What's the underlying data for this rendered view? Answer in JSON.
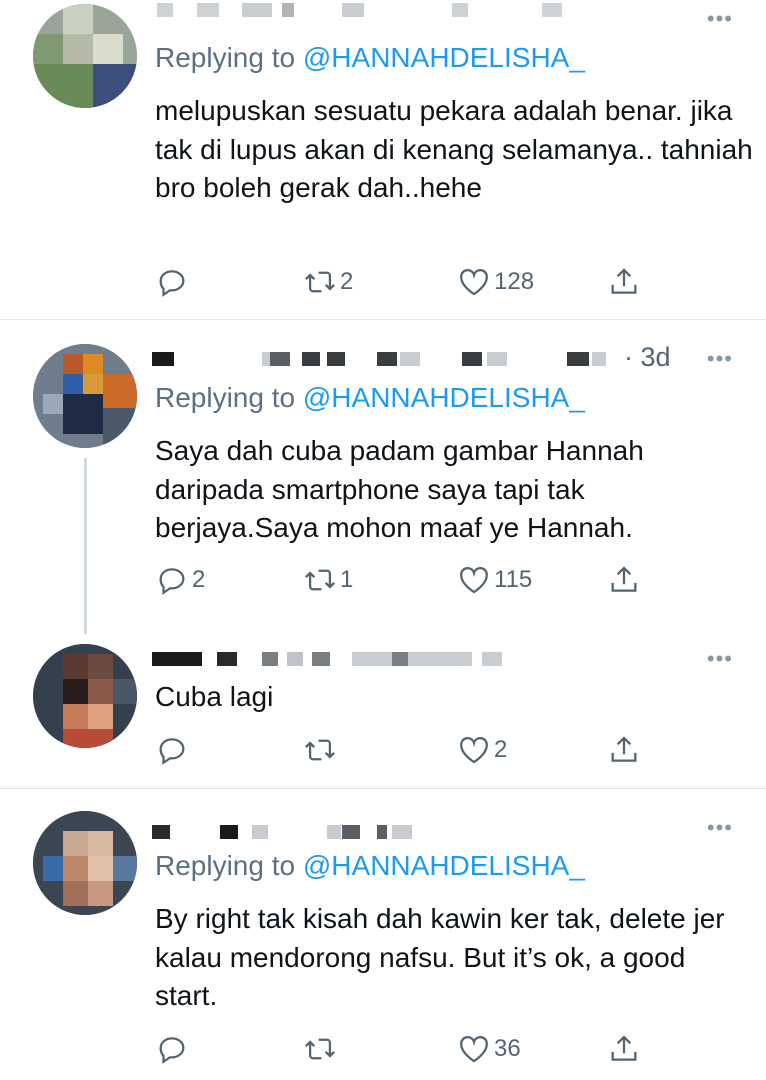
{
  "tweets": [
    {
      "replying_prefix": "Replying to",
      "replying_handle": "@HANNAHDELISHA_",
      "body": "melupuskan sesuatu pekara adalah benar. jika tak di lupus akan di kenang selamanya.. tahniah bro boleh gerak dah..hehe",
      "time": "",
      "replies": "",
      "retweets": "2",
      "likes": "128"
    },
    {
      "replying_prefix": "Replying to",
      "replying_handle": "@HANNAHDELISHA_",
      "body": "Saya dah cuba padam gambar Hannah daripada smartphone saya tapi tak berjaya.Saya mohon maaf ye Hannah.",
      "time": "· 3d",
      "replies": "2",
      "retweets": "1",
      "likes": "115"
    },
    {
      "replying_prefix": "",
      "replying_handle": "",
      "body": "Cuba lagi",
      "time": "",
      "replies": "",
      "retweets": "",
      "likes": "2"
    },
    {
      "replying_prefix": "Replying to",
      "replying_handle": "@HANNAHDELISHA_",
      "body": "By right tak kisah dah kawin ker tak, delete jer kalau mendorong nafsu. But it’s ok, a good start.",
      "time": "",
      "replies": "",
      "retweets": "",
      "likes": "36"
    }
  ],
  "more_label": "•••",
  "icons": [
    "reply-icon",
    "retweet-icon",
    "like-icon",
    "share-icon",
    "more-icon"
  ],
  "colors": {
    "accent": "#1d9bf0",
    "muted": "#536471",
    "divider": "#e1e6ea"
  }
}
